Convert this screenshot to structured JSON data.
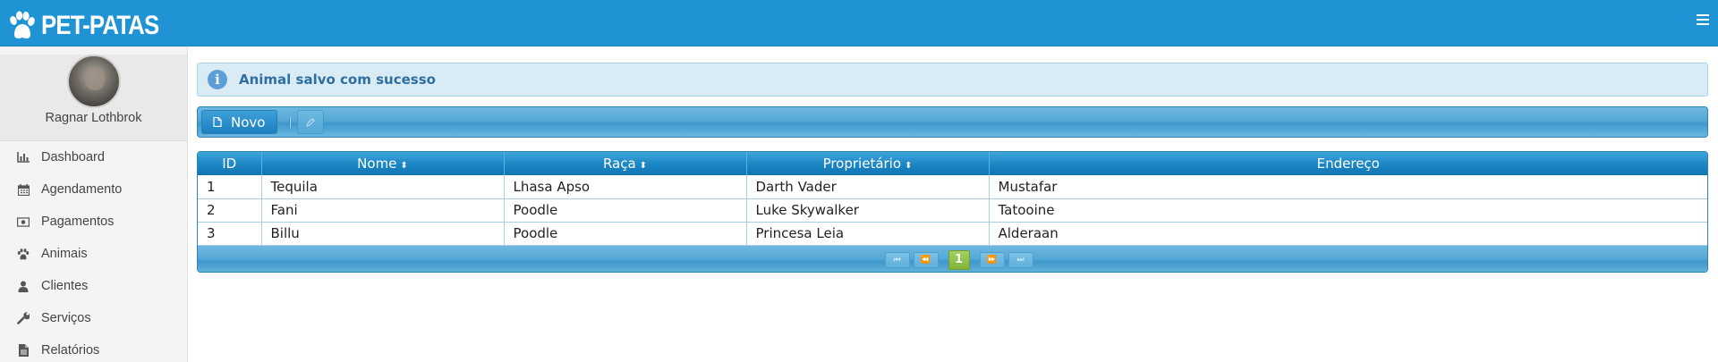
{
  "app": {
    "brand": "PET-PATAS"
  },
  "user": {
    "name": "Ragnar Lothbrok"
  },
  "sidebar": {
    "items": [
      {
        "label": "Dashboard",
        "icon": "bar-chart-icon"
      },
      {
        "label": "Agendamento",
        "icon": "calendar-icon"
      },
      {
        "label": "Pagamentos",
        "icon": "money-icon"
      },
      {
        "label": "Animais",
        "icon": "paw-icon"
      },
      {
        "label": "Clientes",
        "icon": "user-icon"
      },
      {
        "label": "Serviços",
        "icon": "wrench-icon"
      },
      {
        "label": "Relatórios",
        "icon": "document-icon"
      }
    ]
  },
  "message": {
    "text": "Animal salvo com sucesso",
    "icon": "info-icon"
  },
  "toolbar": {
    "new_label": "Novo"
  },
  "table": {
    "columns": [
      "ID",
      "Nome",
      "Raça",
      "Proprietário",
      "Endereço"
    ],
    "rows": [
      [
        "1",
        "Tequila",
        "Lhasa Apso",
        "Darth Vader",
        "Mustafar"
      ],
      [
        "2",
        "Fani",
        "Poodle",
        "Luke Skywalker",
        "Tatooine"
      ],
      [
        "3",
        "Billu",
        "Poodle",
        "Princesa Leia",
        "Alderaan"
      ]
    ]
  },
  "paginator": {
    "current_page": "1"
  },
  "colors": {
    "header_blue": "#1f93d4",
    "active_page_green": "#8cc043"
  }
}
